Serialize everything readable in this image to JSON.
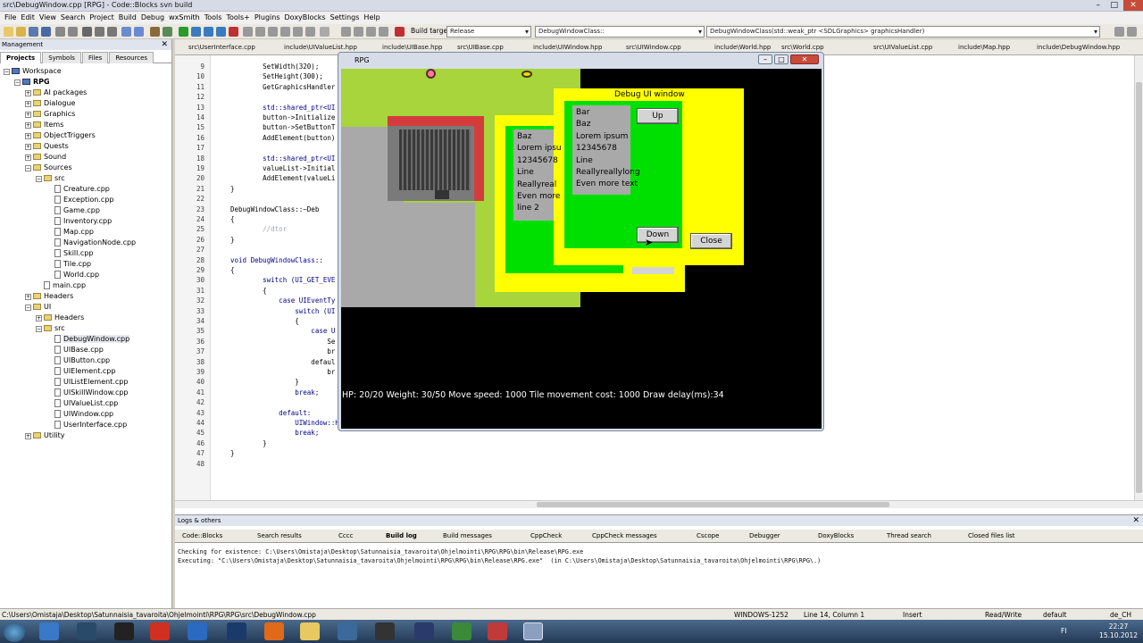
{
  "window": {
    "title": "src\\DebugWindow.cpp [RPG] - Code::Blocks svn build"
  },
  "menu": [
    "File",
    "Edit",
    "View",
    "Search",
    "Project",
    "Build",
    "Debug",
    "wxSmith",
    "Tools",
    "Tools+",
    "Plugins",
    "DoxyBlocks",
    "Settings",
    "Help"
  ],
  "toolbar": {
    "build_target_label": "Build target:",
    "build_target_value": "Release",
    "scope_value": "DebugWindowClass::",
    "symbol_value": "DebugWindowClass(std::weak_ptr <SDLGraphics> graphicsHandler)"
  },
  "management": {
    "title": "Management",
    "tabs": [
      "Projects",
      "Symbols",
      "Files",
      "Resources"
    ],
    "tree": [
      {
        "label": "Workspace",
        "depth": 0,
        "kind": "proj"
      },
      {
        "label": "RPG",
        "depth": 1,
        "kind": "proj",
        "bold": true
      },
      {
        "label": "AI packages",
        "depth": 2,
        "kind": "folder"
      },
      {
        "label": "Dialogue",
        "depth": 2,
        "kind": "folder"
      },
      {
        "label": "Graphics",
        "depth": 2,
        "kind": "folder"
      },
      {
        "label": "Items",
        "depth": 2,
        "kind": "folder"
      },
      {
        "label": "ObjectTriggers",
        "depth": 2,
        "kind": "folder"
      },
      {
        "label": "Quests",
        "depth": 2,
        "kind": "folder"
      },
      {
        "label": "Sound",
        "depth": 2,
        "kind": "folder"
      },
      {
        "label": "Sources",
        "depth": 2,
        "kind": "folder"
      },
      {
        "label": "src",
        "depth": 3,
        "kind": "folder"
      },
      {
        "label": "Creature.cpp",
        "depth": 4,
        "kind": "file"
      },
      {
        "label": "Exception.cpp",
        "depth": 4,
        "kind": "file"
      },
      {
        "label": "Game.cpp",
        "depth": 4,
        "kind": "file"
      },
      {
        "label": "Inventory.cpp",
        "depth": 4,
        "kind": "file"
      },
      {
        "label": "Map.cpp",
        "depth": 4,
        "kind": "file"
      },
      {
        "label": "NavigationNode.cpp",
        "depth": 4,
        "kind": "file"
      },
      {
        "label": "Skill.cpp",
        "depth": 4,
        "kind": "file"
      },
      {
        "label": "Tile.cpp",
        "depth": 4,
        "kind": "file"
      },
      {
        "label": "World.cpp",
        "depth": 4,
        "kind": "file"
      },
      {
        "label": "main.cpp",
        "depth": 3,
        "kind": "file"
      },
      {
        "label": "Headers",
        "depth": 2,
        "kind": "folder"
      },
      {
        "label": "UI",
        "depth": 2,
        "kind": "folder"
      },
      {
        "label": "Headers",
        "depth": 3,
        "kind": "folder"
      },
      {
        "label": "src",
        "depth": 3,
        "kind": "folder"
      },
      {
        "label": "DebugWindow.cpp",
        "depth": 4,
        "kind": "file",
        "selected": true
      },
      {
        "label": "UIBase.cpp",
        "depth": 4,
        "kind": "file"
      },
      {
        "label": "UIButton.cpp",
        "depth": 4,
        "kind": "file"
      },
      {
        "label": "UIElement.cpp",
        "depth": 4,
        "kind": "file"
      },
      {
        "label": "UIListElement.cpp",
        "depth": 4,
        "kind": "file"
      },
      {
        "label": "UISkillWindow.cpp",
        "depth": 4,
        "kind": "file"
      },
      {
        "label": "UIValueList.cpp",
        "depth": 4,
        "kind": "file"
      },
      {
        "label": "UIWindow.cpp",
        "depth": 4,
        "kind": "file"
      },
      {
        "label": "UserInterface.cpp",
        "depth": 4,
        "kind": "file"
      },
      {
        "label": "Utility",
        "depth": 2,
        "kind": "folder"
      }
    ]
  },
  "editor": {
    "tabs": [
      "src\\UserInterface.cpp",
      "include\\UIValueList.hpp",
      "include\\UIBase.hpp",
      "src\\UIBase.cpp",
      "include\\UIWindow.hpp",
      "src\\UIWindow.cpp",
      "include\\World.hpp",
      "src\\World.cpp",
      "src\\UIValueList.cpp",
      "include\\Map.hpp",
      "include\\DebugWindow.hpp"
    ],
    "lines": [
      {
        "n": "9",
        "code": "        SetWidth(320);"
      },
      {
        "n": "10",
        "code": "        SetHeight(300);"
      },
      {
        "n": "11",
        "code": "        GetGraphicsHandler"
      },
      {
        "n": "12",
        "code": ""
      },
      {
        "n": "13",
        "code": "        std::shared_ptr<UI"
      },
      {
        "n": "14",
        "code": "        button->Initialize"
      },
      {
        "n": "15",
        "code": "        button->SetButtonT"
      },
      {
        "n": "16",
        "code": "        AddElement(button)"
      },
      {
        "n": "17",
        "code": ""
      },
      {
        "n": "18",
        "code": "        std::shared_ptr<UI"
      },
      {
        "n": "19",
        "code": "        valueList->Initial"
      },
      {
        "n": "20",
        "code": "        AddElement(valueLi"
      },
      {
        "n": "21",
        "code": "}"
      },
      {
        "n": "22",
        "code": ""
      },
      {
        "n": "23",
        "code": "DebugWindowClass::~Deb"
      },
      {
        "n": "24",
        "code": "{"
      },
      {
        "n": "25",
        "code": "        //dtor"
      },
      {
        "n": "26",
        "code": "}"
      },
      {
        "n": "27",
        "code": ""
      },
      {
        "n": "28",
        "code": "void DebugWindowClass::"
      },
      {
        "n": "29",
        "code": "{"
      },
      {
        "n": "30",
        "code": "        switch (UI_GET_EVE"
      },
      {
        "n": "31",
        "code": "        {"
      },
      {
        "n": "32",
        "code": "            case UIEventTy"
      },
      {
        "n": "33",
        "code": "                switch (UI"
      },
      {
        "n": "34",
        "code": "                {"
      },
      {
        "n": "35",
        "code": "                    case U"
      },
      {
        "n": "36",
        "code": "                        Se"
      },
      {
        "n": "37",
        "code": "                        br"
      },
      {
        "n": "38",
        "code": "                    defaul"
      },
      {
        "n": "39",
        "code": "                        br"
      },
      {
        "n": "40",
        "code": "                }"
      },
      {
        "n": "41",
        "code": "                break;"
      },
      {
        "n": "42",
        "code": ""
      },
      {
        "n": "43",
        "code": "            default:"
      },
      {
        "n": "44",
        "code": "                UIWindow::HandleEvent(event); // default event handler"
      },
      {
        "n": "45",
        "code": "                break;"
      },
      {
        "n": "46",
        "code": "        }"
      },
      {
        "n": "47",
        "code": "}"
      },
      {
        "n": "48",
        "code": ""
      }
    ]
  },
  "rpg": {
    "title": "RPG",
    "status": "HP: 20/20 Weight: 30/50 Move speed: 1000 Tile movement cost: 1000 Draw delay(ms):34",
    "debug_title": "Debug UI window",
    "list_back": [
      "Baz",
      "Lorem ipsu",
      "12345678",
      "Line",
      "Reallyreal",
      "Even more",
      "line 2"
    ],
    "list_front": [
      "Bar",
      "Baz",
      "Lorem ipsum",
      "12345678",
      "Line",
      "Reallyreallylong",
      "Even more text"
    ],
    "up": "Up",
    "down": "Down",
    "close": "Close"
  },
  "logs": {
    "title": "Logs & others",
    "tabs": [
      "Code::Blocks",
      "Search results",
      "Cccc",
      "Build log",
      "Build messages",
      "CppCheck",
      "CppCheck messages",
      "Cscope",
      "Debugger",
      "DoxyBlocks",
      "Thread search",
      "Closed files list"
    ],
    "lines": [
      "Checking for existence: C:\\Users\\Omistaja\\Desktop\\Satunnaisia_tavaroita\\Ohjelmointi\\RPG\\RPG\\bin\\Release\\RPG.exe",
      "Executing: \"C:\\Users\\Omistaja\\Desktop\\Satunnaisia_tavaroita\\Ohjelmointi\\RPG\\RPG\\bin\\Release\\RPG.exe\"  (in C:\\Users\\Omistaja\\Desktop\\Satunnaisia_tavaroita\\Ohjelmointi\\RPG\\RPG\\.)"
    ]
  },
  "status": {
    "path": "C:\\Users\\Omistaja\\Desktop\\Satunnaisia_tavaroita\\Ohjelmointi\\RPG\\RPG\\src\\DebugWindow.cpp",
    "encoding": "WINDOWS-1252",
    "position": "Line 14, Column 1",
    "mode": "Insert",
    "access": "Read/Write",
    "style": "default",
    "locale": "de_CH"
  },
  "taskbar": {
    "lang": "FI",
    "time": "22:27",
    "date": "15.10.2012"
  }
}
